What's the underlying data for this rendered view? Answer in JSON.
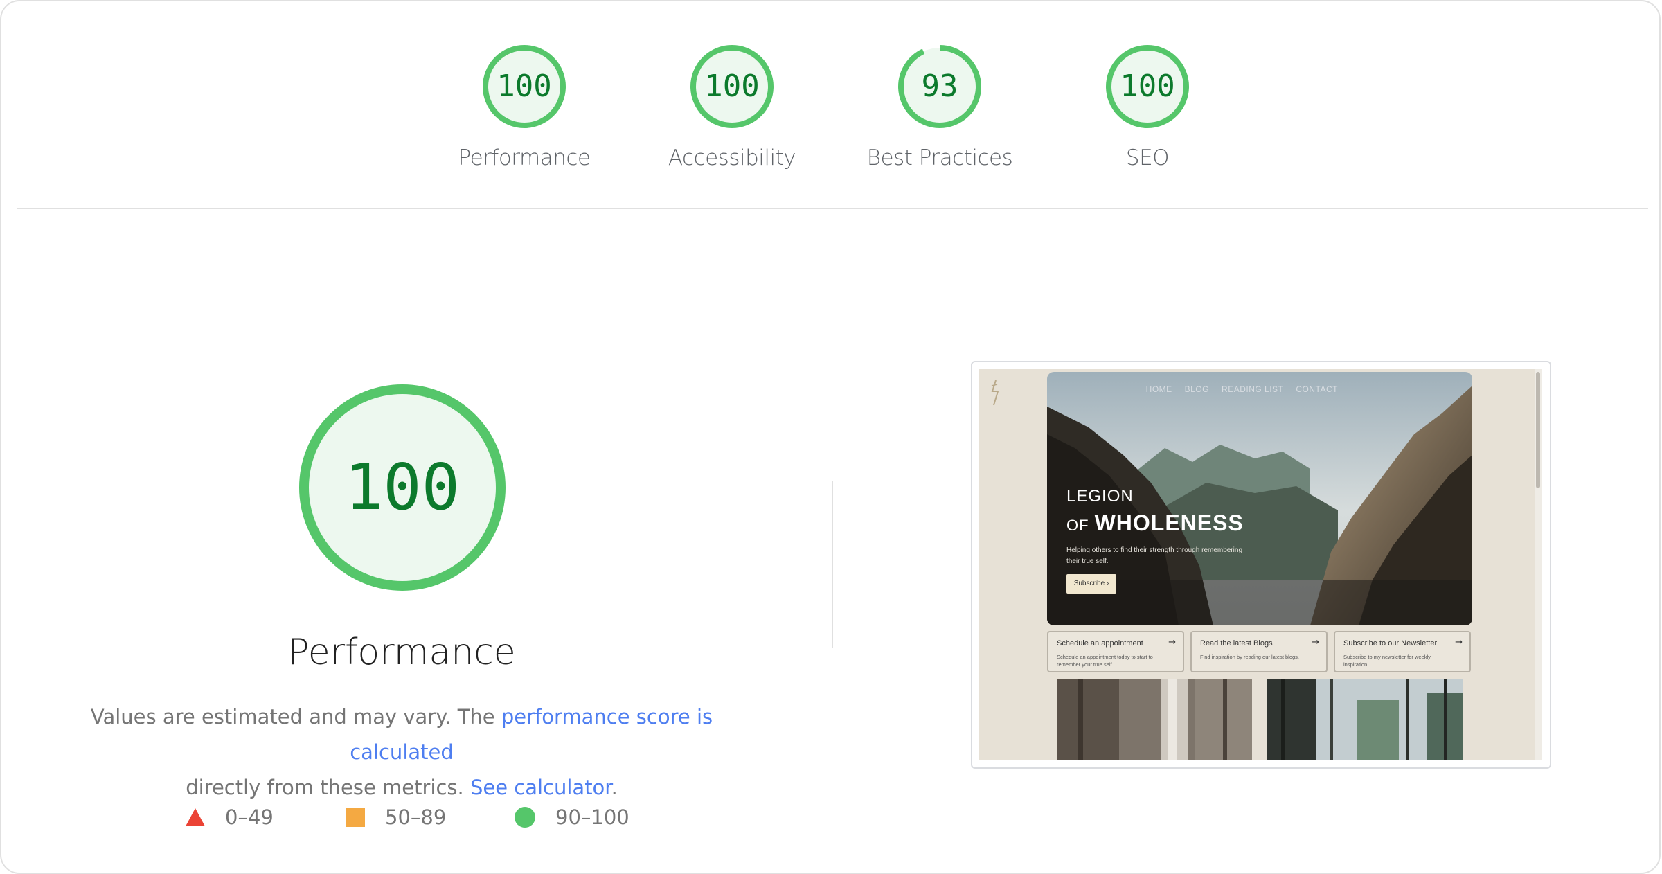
{
  "scores": [
    {
      "label": "Performance",
      "value": "100",
      "score": 100
    },
    {
      "label": "Accessibility",
      "value": "100",
      "score": 100
    },
    {
      "label": "Best Practices",
      "value": "93",
      "score": 93
    },
    {
      "label": "SEO",
      "value": "100",
      "score": 100
    }
  ],
  "main": {
    "score": "100",
    "title": "Performance",
    "desc_prefix": "Values are estimated and may vary. The ",
    "desc_link1": "performance score is calculated",
    "desc_middle": " directly from these metrics. ",
    "desc_link2": "See calculator",
    "desc_suffix": "."
  },
  "legend": [
    {
      "range": "0–49",
      "shape": "triangle",
      "color": "#eb4335"
    },
    {
      "range": "50–89",
      "shape": "square",
      "color": "#f4a942"
    },
    {
      "range": "90–100",
      "shape": "circle",
      "color": "#55c66a"
    }
  ],
  "colors": {
    "pass": "#55c66a",
    "pass_fill": "#edf8ef",
    "pass_text": "#0c7a2c",
    "link": "#4e7ef0"
  },
  "thumbnail": {
    "nav": [
      "HOME",
      "BLOG",
      "READING LIST",
      "CONTACT"
    ],
    "hero_line1": "LEGION",
    "hero_of": "OF",
    "hero_big": "WHOLENESS",
    "hero_sub": "Helping others to find their strength through remembering their true self.",
    "hero_button": "Subscribe ›",
    "cards": [
      {
        "title": "Schedule an appointment",
        "arrow": "→",
        "sub": "Schedule an appointment today to start to remember your true self."
      },
      {
        "title": "Read the latest Blogs",
        "arrow": "→",
        "sub": "Find inspiration by reading our latest blogs."
      },
      {
        "title": "Subscribe to our Newsletter",
        "arrow": "→",
        "sub": "Subscribe to my newsletter for weekly inspiration."
      }
    ]
  }
}
